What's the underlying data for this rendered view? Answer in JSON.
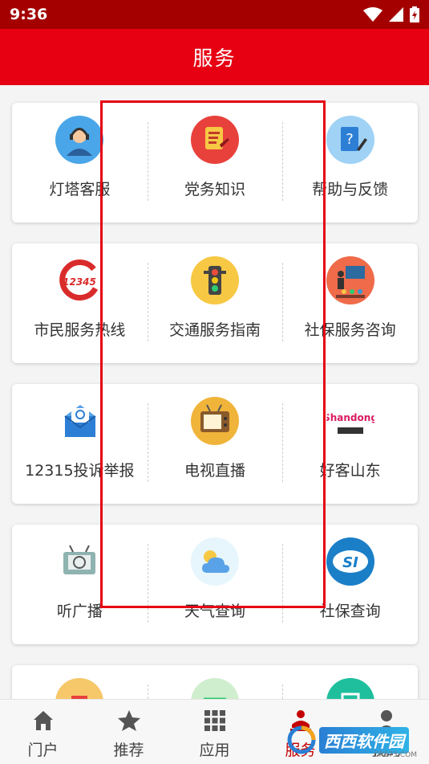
{
  "status_bar": {
    "time": "9:36"
  },
  "header": {
    "title": "服务"
  },
  "grid": [
    [
      {
        "label": "灯塔客服",
        "icon": "customer-service-icon",
        "color": "#4aa6e8"
      },
      {
        "label": "党务知识",
        "icon": "party-knowledge-icon",
        "color": "#e8413c"
      },
      {
        "label": "帮助与反馈",
        "icon": "help-feedback-icon",
        "color": "#62b6ee"
      }
    ],
    [
      {
        "label": "市民服务热线",
        "icon": "hotline-12345-icon",
        "color": "#d92b2b",
        "text": "12345"
      },
      {
        "label": "交通服务指南",
        "icon": "traffic-light-icon",
        "color": "#f7c844"
      },
      {
        "label": "社保服务咨询",
        "icon": "consult-meeting-icon",
        "color": "#ef6b4a"
      }
    ],
    [
      {
        "label": "12315投诉举报",
        "icon": "complaint-mail-icon",
        "color": "#2d7fd6"
      },
      {
        "label": "电视直播",
        "icon": "tv-live-icon",
        "color": "#f0b43a"
      },
      {
        "label": "好客山东",
        "icon": "shandong-logo-icon",
        "color": "#ffffff",
        "text": "Shandong"
      }
    ],
    [
      {
        "label": "听广播",
        "icon": "radio-icon",
        "color": "#ffffff"
      },
      {
        "label": "天气查询",
        "icon": "weather-icon",
        "color": "#e6f6fc"
      },
      {
        "label": "社保查询",
        "icon": "social-security-icon",
        "color": "#1b7fc8",
        "text": "SI"
      }
    ],
    [
      {
        "label": "",
        "icon": "partial-orange-icon",
        "color": "#f7c86a"
      },
      {
        "label": "",
        "icon": "partial-green-icon",
        "color": "#cfeecd"
      },
      {
        "label": "",
        "icon": "partial-teal-icon",
        "color": "#1fbf9e"
      }
    ]
  ],
  "bottom_nav": [
    {
      "label": "门户",
      "icon": "home-icon"
    },
    {
      "label": "推荐",
      "icon": "star-icon"
    },
    {
      "label": "应用",
      "icon": "apps-grid-icon"
    },
    {
      "label": "服务",
      "icon": "service-icon",
      "active": true
    },
    {
      "label": "我的",
      "icon": "profile-icon"
    }
  ],
  "watermark": {
    "text": "西西软件园",
    "sub": "CR173.COM"
  },
  "colors": {
    "header": "#e60012",
    "status_bar": "#a40000",
    "highlight": "#e60012"
  }
}
